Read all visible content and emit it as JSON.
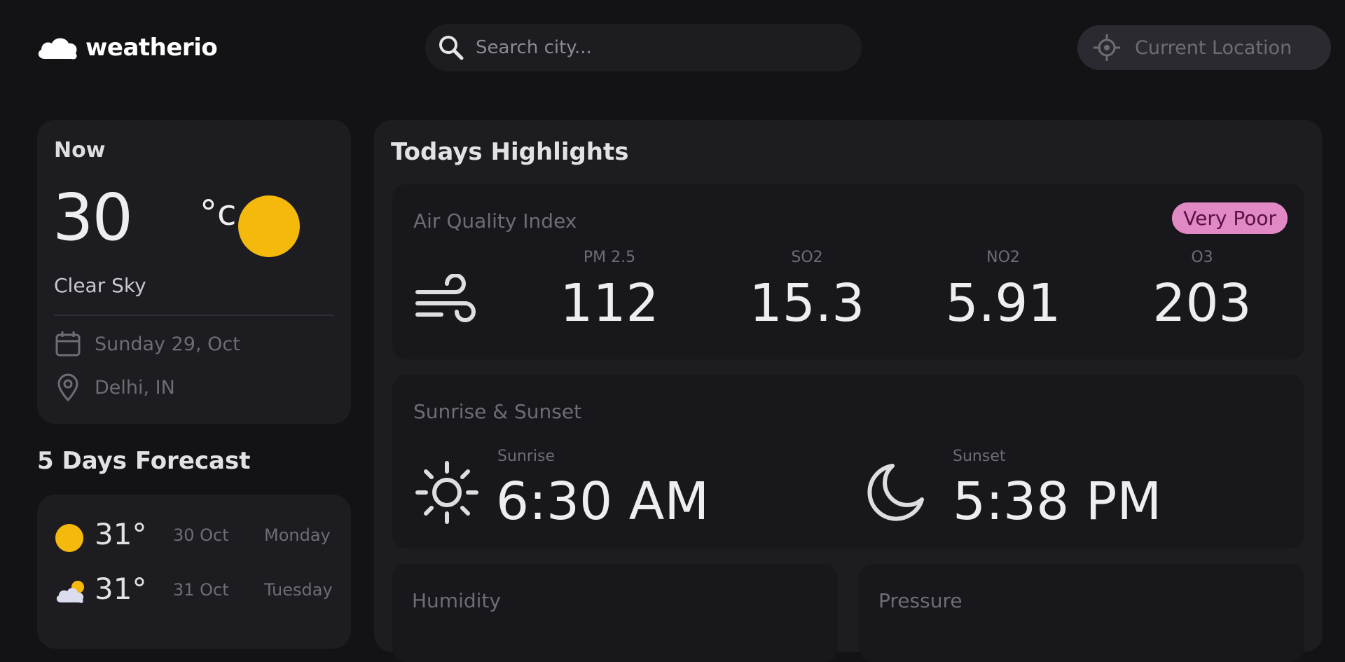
{
  "header": {
    "logo_text": "weatherio",
    "search": {
      "placeholder": "Search city..."
    },
    "location_button": {
      "label": "Current Location"
    }
  },
  "now": {
    "title": "Now",
    "temperature": "30",
    "unit": "°c",
    "condition": "Clear Sky",
    "date": "Sunday 29, Oct",
    "location": "Delhi, IN",
    "icon": "sun-icon"
  },
  "forecast": {
    "title": "5 Days Forecast",
    "items": [
      {
        "temp": "31°",
        "date": "30 Oct",
        "day": "Monday",
        "icon": "sun-icon"
      },
      {
        "temp": "31°",
        "date": "31 Oct",
        "day": "Tuesday",
        "icon": "partly-cloudy-icon"
      }
    ]
  },
  "highlights": {
    "title": "Todays Highlights",
    "aqi": {
      "label": "Air Quality Index",
      "badge": "Very Poor",
      "badge_color": "#e089c4",
      "metrics": [
        {
          "label": "PM 2.5",
          "value": "112"
        },
        {
          "label": "SO2",
          "value": "15.3"
        },
        {
          "label": "NO2",
          "value": "5.91"
        },
        {
          "label": "O3",
          "value": "203"
        }
      ]
    },
    "sun": {
      "title": "Sunrise & Sunset",
      "sunrise": {
        "label": "Sunrise",
        "time": "6:30 AM"
      },
      "sunset": {
        "label": "Sunset",
        "time": "5:38 PM"
      }
    },
    "humidity": {
      "label": "Humidity"
    },
    "pressure": {
      "label": "Pressure"
    }
  },
  "colors": {
    "background": "#131316",
    "card": "#1d1c20",
    "sun": "#f5b90b",
    "muted_text": "#6e6d74"
  }
}
